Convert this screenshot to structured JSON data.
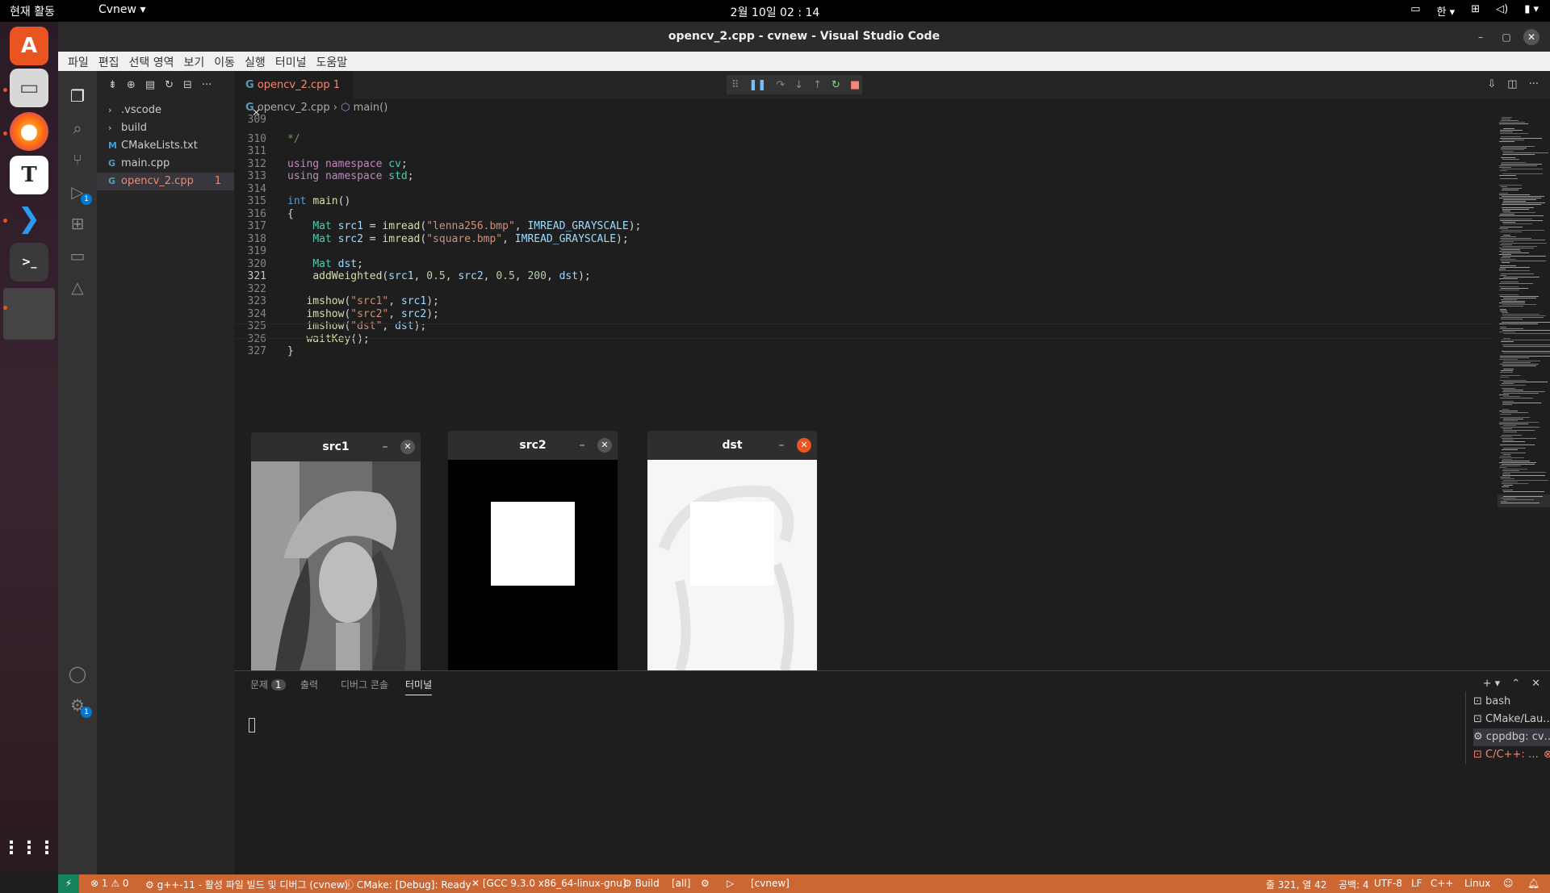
{
  "topbar": {
    "activities": "현재 활동",
    "app_menu": "Cvnew ▾",
    "clock": "2월 10일  02 : 14",
    "lang": "한 ▾"
  },
  "dock": {
    "items": [
      "ubuntu-software-icon",
      "files-icon",
      "firefox-icon",
      "text-editor-icon",
      "vscode-icon",
      "terminal-icon",
      "opencv-window-icon"
    ],
    "show_apps": "⋮⋮⋮"
  },
  "window": {
    "title": "opencv_2.cpp - cvnew - Visual Studio Code"
  },
  "menu": [
    "파일",
    "편집",
    "선택 영역",
    "보기",
    "이동",
    "실행",
    "터미널",
    "도움말"
  ],
  "explorer": {
    "items": [
      {
        "label": ".vscode",
        "icon": "›"
      },
      {
        "label": "build",
        "icon": "›"
      },
      {
        "label": "CMakeLists.txt",
        "icon": "M"
      },
      {
        "label": "main.cpp",
        "icon": "G"
      },
      {
        "label": "opencv_2.cpp",
        "icon": "G",
        "badge": "1"
      }
    ]
  },
  "tab": {
    "label": "opencv_2.cpp",
    "count": "1"
  },
  "breadcrumb": {
    "file": "opencv_2.cpp",
    "symbol": "main()"
  },
  "code": {
    "lines": [
      {
        "n": "309",
        "text": ""
      },
      {
        "n": "310",
        "text": "*/"
      },
      {
        "n": "311",
        "text": ""
      },
      {
        "n": "312",
        "text": "using namespace cv;"
      },
      {
        "n": "313",
        "text": "using namespace std;"
      },
      {
        "n": "314",
        "text": ""
      },
      {
        "n": "315",
        "text": "int main()"
      },
      {
        "n": "316",
        "text": "{"
      },
      {
        "n": "317",
        "text": "    Mat src1 = imread(\"lenna256.bmp\", IMREAD_GRAYSCALE);"
      },
      {
        "n": "318",
        "text": "    Mat src2 = imread(\"square.bmp\", IMREAD_GRAYSCALE);"
      },
      {
        "n": "319",
        "text": ""
      },
      {
        "n": "320",
        "text": "    Mat dst;"
      },
      {
        "n": "321",
        "text": "    addWeighted(src1, 0.5, src2, 0.5, 200, dst);"
      },
      {
        "n": "322",
        "text": ""
      },
      {
        "n": "323",
        "text": "   imshow(\"src1\", src1);"
      },
      {
        "n": "324",
        "text": "   imshow(\"src2\", src2);"
      },
      {
        "n": "325",
        "text": "   imshow(\"dst\", dst);"
      },
      {
        "n": "326",
        "text": "   waitKey();"
      },
      {
        "n": "327",
        "text": "}"
      }
    ]
  },
  "cv_windows": [
    {
      "title": "src1"
    },
    {
      "title": "src2"
    },
    {
      "title": "dst"
    }
  ],
  "panel": {
    "tabs": [
      "문제",
      "출력",
      "디버그 콘솔",
      "터미널"
    ],
    "problems_count": "1",
    "terminals": [
      "bash",
      "CMake/Lau…",
      "cppdbg: cv…",
      "C/C++: …"
    ]
  },
  "status": {
    "errors": "⊗ 1 ⚠ 0",
    "build_task": "g++-11 - 활성 파일 빌드 및 디버그 (cvnew)",
    "cmake": "ⓘ CMake: [Debug]: Ready",
    "kit": "[GCC 9.3.0 x86_64-linux-gnu]",
    "build": "⚙ Build",
    "target": "[all]",
    "project": "[cvnew]",
    "position": "줄 321, 열 42",
    "spaces": "공백: 4",
    "encoding": "UTF-8",
    "eol": "LF",
    "language": "C++",
    "platform": "Linux"
  },
  "colors": {
    "accent": "#cc6633",
    "error": "#f48771",
    "ubuntu": "#e95420"
  }
}
